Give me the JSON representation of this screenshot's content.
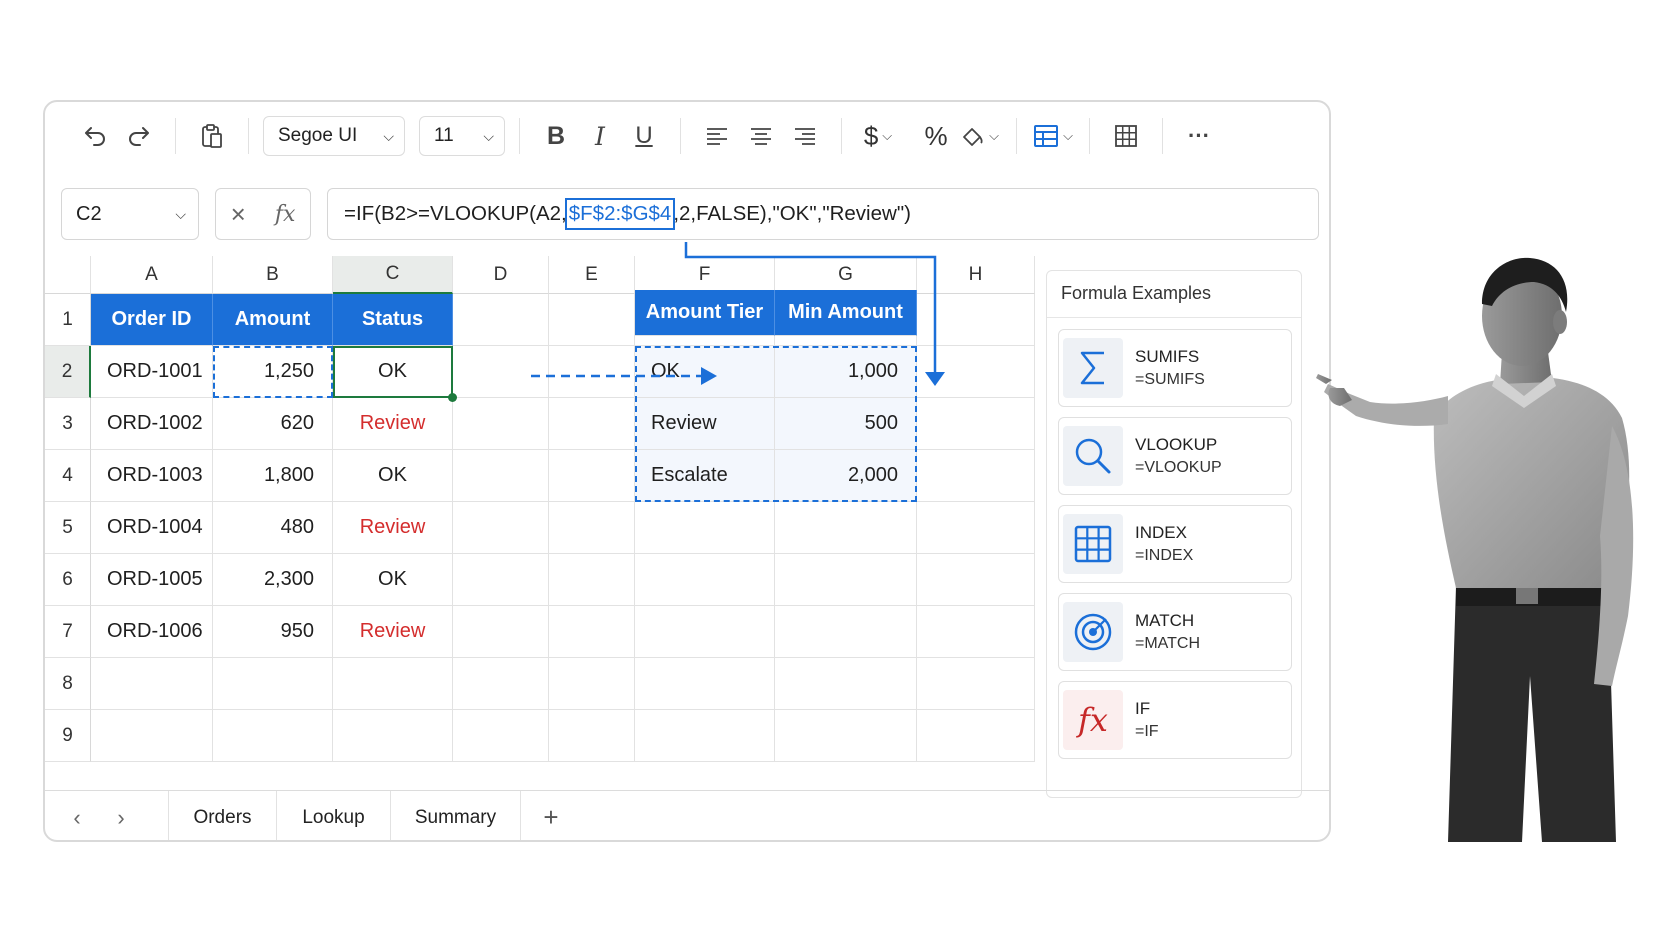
{
  "toolbar": {
    "font_name": "Segoe UI",
    "font_size": "11",
    "bold": "B",
    "italic": "I",
    "underline": "U",
    "currency": "$",
    "percent": "%",
    "more": "···"
  },
  "formula_bar": {
    "name_box": "C2",
    "formula_prefix": "=IF(B2>=VLOOKUP(A2,",
    "formula_ref": "$F$2:$G$4",
    "formula_suffix": ",2,FALSE),\"OK\",\"Review\")"
  },
  "columns": [
    "A",
    "B",
    "C",
    "D",
    "E",
    "F",
    "G",
    "H"
  ],
  "rows": [
    "1",
    "2",
    "3",
    "4",
    "5",
    "6",
    "7",
    "8",
    "9"
  ],
  "orders": {
    "headers": [
      "Order ID",
      "Amount",
      "Status"
    ],
    "rows": [
      [
        "ORD-1001",
        "1,250",
        "OK"
      ],
      [
        "ORD-1002",
        "620",
        "Review"
      ],
      [
        "ORD-1003",
        "1,800",
        "OK"
      ],
      [
        "ORD-1004",
        "480",
        "Review"
      ],
      [
        "ORD-1005",
        "2,300",
        "OK"
      ],
      [
        "ORD-1006",
        "950",
        "Review"
      ]
    ]
  },
  "lookup": {
    "headers": [
      "Amount Tier",
      "Min Amount"
    ],
    "rows": [
      [
        "OK",
        "1,000"
      ],
      [
        "Review",
        "500"
      ],
      [
        "Escalate",
        "2,000"
      ]
    ]
  },
  "examples": {
    "title": "Formula Examples",
    "items": [
      {
        "name": "SUMIFS",
        "formula": "=SUMIFS",
        "icon": "sigma-icon"
      },
      {
        "name": "VLOOKUP",
        "formula": "=VLOOKUP",
        "icon": "search-icon"
      },
      {
        "name": "INDEX",
        "formula": "=INDEX",
        "icon": "grid-icon"
      },
      {
        "name": "MATCH",
        "formula": "=MATCH",
        "icon": "target-icon"
      },
      {
        "name": "IF",
        "formula": "=IF",
        "icon": "fx-icon"
      }
    ]
  },
  "sheets": [
    "Orders",
    "Lookup",
    "Summary"
  ],
  "colors": {
    "accent_blue": "#1b6fd8",
    "active_green": "#1d7a3d",
    "review_red": "#d42d2d",
    "if_icon_red": "#c62828"
  }
}
